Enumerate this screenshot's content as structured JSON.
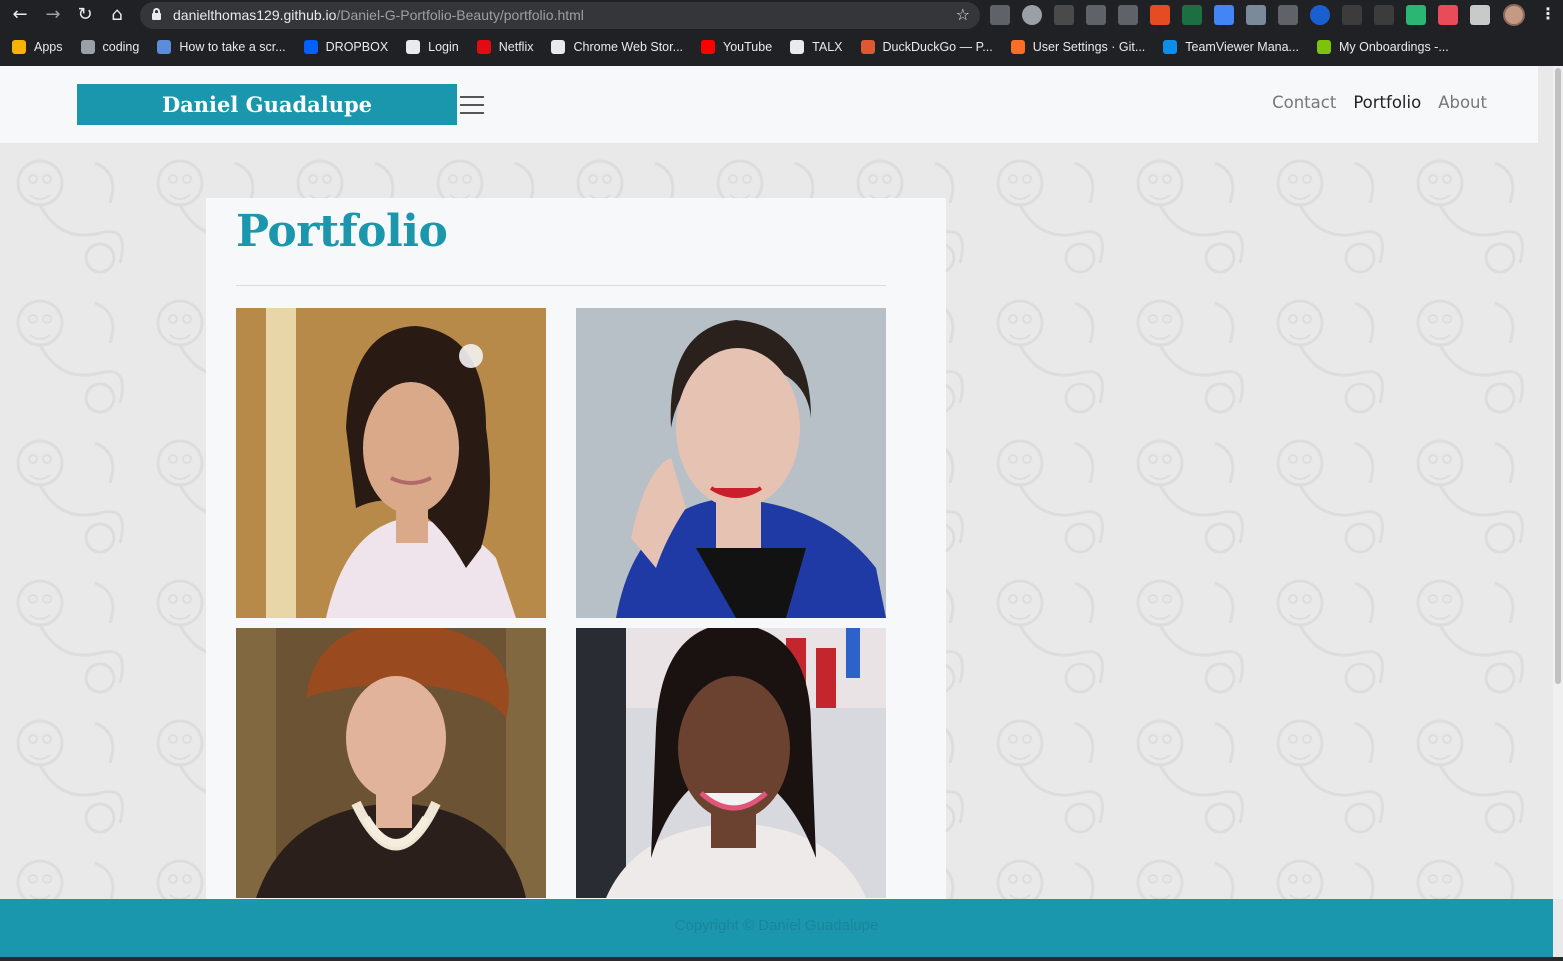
{
  "browser": {
    "url_host": "danielthomas129.github.io",
    "url_path": "/Daniel-G-Portfolio-Beauty/portfolio.html",
    "bookmarks": [
      {
        "label": "Apps",
        "icon": "apps-grid-icon",
        "color": "#f4b400"
      },
      {
        "label": "coding",
        "icon": "folder-icon",
        "color": "#9aa0a6"
      },
      {
        "label": "How to take a scr...",
        "icon": "screenshot-icon",
        "color": "#5b8dd9"
      },
      {
        "label": "DROPBOX",
        "icon": "dropbox-icon",
        "color": "#0061ff"
      },
      {
        "label": "Login",
        "icon": "globe-icon",
        "color": "#e8eaed"
      },
      {
        "label": "Netflix",
        "icon": "netflix-icon",
        "color": "#e50914"
      },
      {
        "label": "Chrome Web Stor...",
        "icon": "chrome-store-icon",
        "color": "#e8eaed"
      },
      {
        "label": "YouTube",
        "icon": "youtube-icon",
        "color": "#ff0000"
      },
      {
        "label": "TALX",
        "icon": "globe-icon",
        "color": "#e8eaed"
      },
      {
        "label": "DuckDuckGo — P...",
        "icon": "duckduckgo-icon",
        "color": "#de5833"
      },
      {
        "label": "User Settings · Git...",
        "icon": "gitlab-icon",
        "color": "#fc6d26"
      },
      {
        "label": "TeamViewer Mana...",
        "icon": "teamviewer-icon",
        "color": "#0e8ee9"
      },
      {
        "label": "My Onboardings -...",
        "icon": "onboarding-icon",
        "color": "#7dc30b"
      }
    ]
  },
  "site": {
    "brand": "Daniel Guadalupe",
    "nav": [
      "Contact",
      "Portfolio",
      "About"
    ],
    "page_title": "Portfolio",
    "footer": "Copyright © Daniel Guadalupe",
    "accent_color": "#1a97ad"
  },
  "photos": [
    {
      "alt": "bride-portrait",
      "bg": "#b88a4a",
      "skin": "#d9a98a",
      "hair": "#2a1a14",
      "garment": "#f0e4ec"
    },
    {
      "alt": "red-lip-portrait",
      "bg": "#b7c0c7",
      "skin": "#e6c2b3",
      "hair": "#2b211c",
      "garment": "#1f3aa5"
    },
    {
      "alt": "vintage-pearls-portrait",
      "bg": "#6b5333",
      "skin": "#e1b39a",
      "hair": "#9a4a1f",
      "garment": "#2a1f1a"
    },
    {
      "alt": "store-portrait",
      "bg": "#d7d9df",
      "skin": "#6b4230",
      "hair": "#1a1210",
      "garment": "#efeaea"
    }
  ]
}
